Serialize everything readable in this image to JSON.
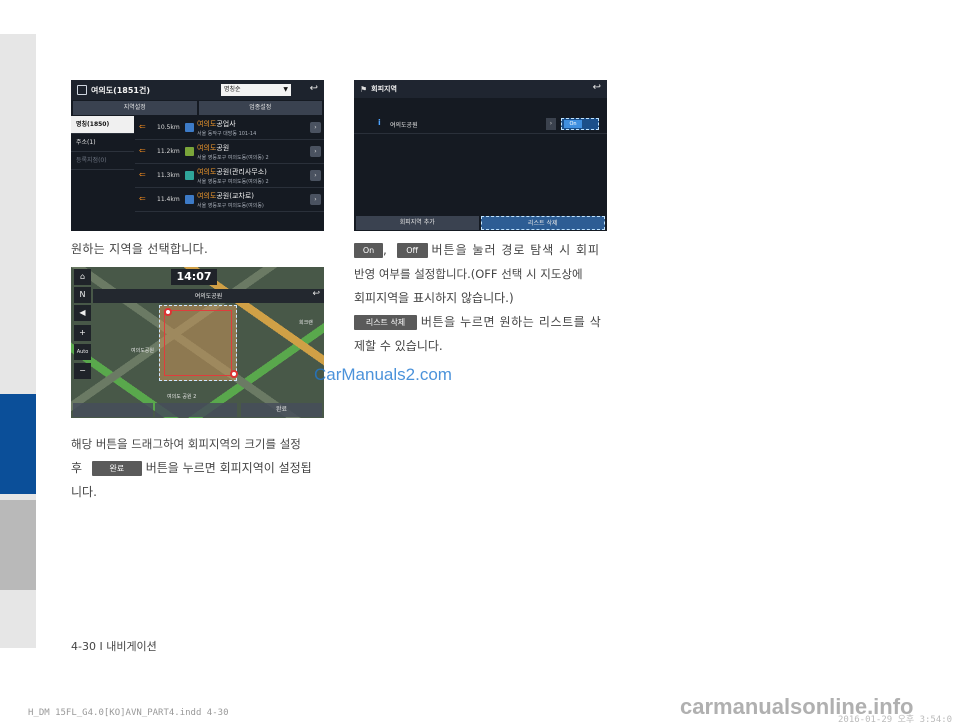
{
  "screen1": {
    "title": "여의도(1851건)",
    "sort_label": "명칭순",
    "btn_region": "지역설정",
    "btn_category": "업종설정",
    "tabs": [
      {
        "label": "명칭(1850)"
      },
      {
        "label": "주소(1)"
      },
      {
        "label": "등록지점(0)"
      }
    ],
    "rows": [
      {
        "dist": "10.5km",
        "hl": "여의도",
        "name": "공업사",
        "addr": "서울 동작구 대방동 101-14"
      },
      {
        "dist": "11.2km",
        "hl": "여의도",
        "name": "공원",
        "addr": "서울 영등포구 여의도동(여의동) 2"
      },
      {
        "dist": "11.3km",
        "hl": "여의도",
        "name": "공원(관리사무소)",
        "addr": "서울 영등포구 여의도동(여의동) 2"
      },
      {
        "dist": "11.4km",
        "hl": "여의도",
        "name": "공원(교차로)",
        "addr": "서울 영등포구 여의도동(여의동)"
      }
    ]
  },
  "caption1": "원하는 지역을 선택합니다.",
  "screen2": {
    "title": "회피지역",
    "item_name": "여의도공원",
    "toggle_label": "On",
    "btn_add": "회피지역 추가",
    "btn_delete": "리스트 삭제"
  },
  "screen3": {
    "time": "14:07",
    "place": "여의도공원",
    "ctrl_auto": "Auto",
    "btn_done": "완료",
    "map_labels": [
      "여의도공원",
      "희크랜",
      "여의도 공원 2"
    ]
  },
  "para_right": {
    "chip_on": "On",
    "comma": ",",
    "chip_off": "Off",
    "line1": "버튼을 눌러 경로 탐색 시 회피",
    "line2": "반영 여부를 설정합니다.(OFF 선택 시 지도상에",
    "line3": "회피지역을 표시하지 않습니다.)",
    "chip_delete": "리스트 삭제",
    "line4": "버튼을 누르면 원하는 리스트를 삭",
    "line5": "제할 수 있습니다."
  },
  "para_left": {
    "line1": "해당 버튼을 드래그하여 회피지역의 크기를 설정",
    "line2a": "후",
    "chip_done": "완료",
    "line2b": "버튼을 누르면 회피지역이 설정됩",
    "line3": "니다."
  },
  "footer": "4-30 I 내비게이션",
  "watermark": "CarManuals2.com",
  "slug": "H_DM 15FL_G4.0[KO]AVN_PART4.indd   4-30",
  "slug_right": "2016-01-29  오후 3:54:0",
  "watermark2": "carmanualsonline.info"
}
